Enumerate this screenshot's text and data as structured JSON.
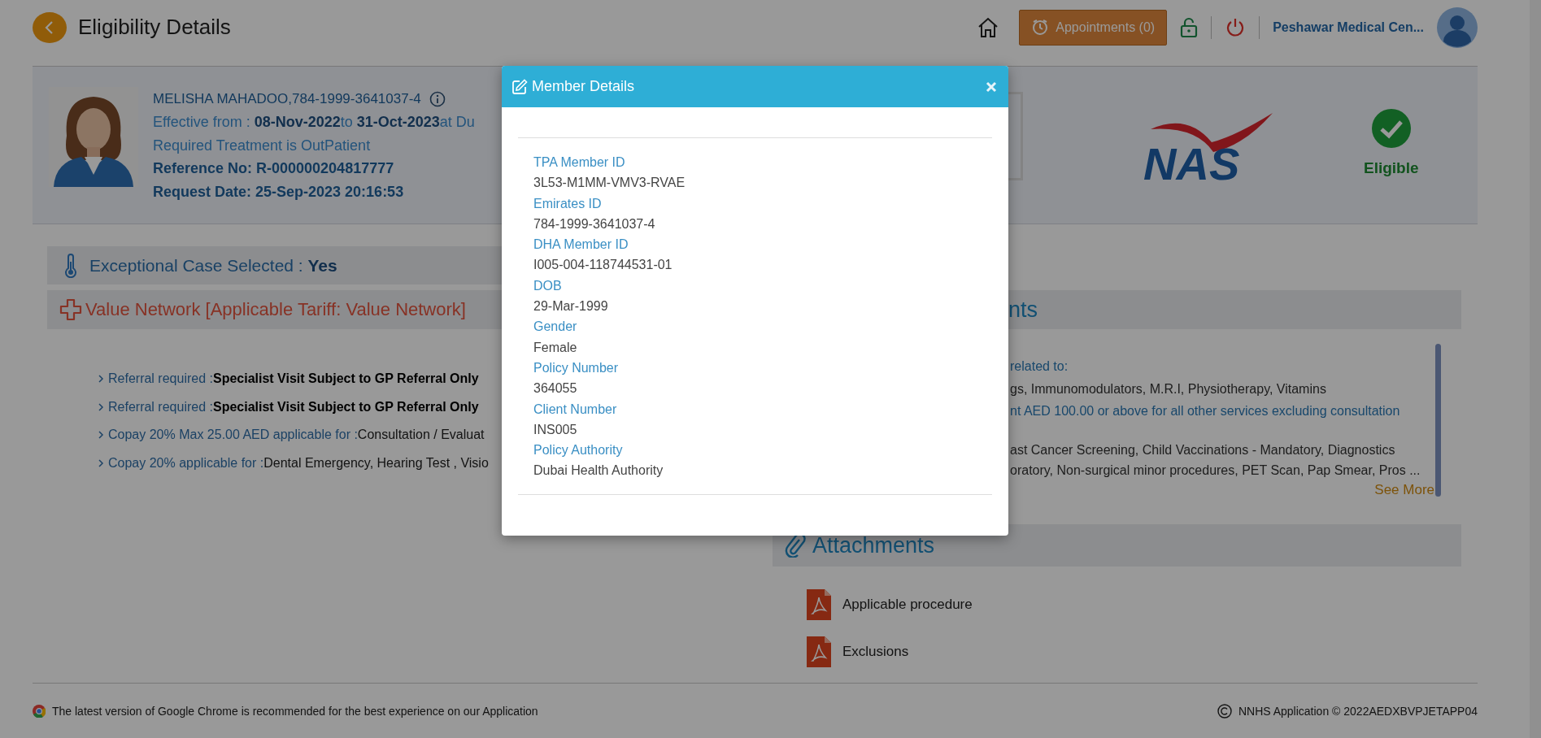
{
  "header": {
    "title": "Eligibility Details",
    "appointments": "Appointments (0)",
    "hospital": "Peshawar Medical Cen..."
  },
  "patient": {
    "name_line": "MELISHA MAHADOO,784-1999-3641037-4",
    "effective": "Effective from : **08-Nov-2022**to **31-Oct-2023**at Du",
    "treatment": "Required Treatment is OutPatient",
    "reference": "Reference No: R-000000204817777",
    "request_date": "Request Date: 25-Sep-2023 20:16:53"
  },
  "insurer": {
    "logo_text": "NAS",
    "status": "Eligible",
    "eligible": true
  },
  "exceptional": {
    "label": "Exceptional Case Selected : ",
    "value": "Yes"
  },
  "network": "Value Network [Applicable Tariff: Value Network]",
  "rules": [
    {
      "label": "Referral required :",
      "value": "Specialist Visit Subject to GP Referral Only",
      "emphasis": true
    },
    {
      "label": "Referral required :",
      "value": "Specialist Visit Subject to GP Referral Only",
      "emphasis": true
    },
    {
      "label": "Copay 20% Max 25.00 AED applicable for :",
      "value": "Consultation / Evaluat",
      "emphasis": false
    },
    {
      "label": "Copay 20% applicable for :",
      "value": "Dental Emergency, Hearing Test , Visio",
      "emphasis": false
    }
  ],
  "requirements": {
    "heading": "nts",
    "lines": [
      {
        "kind": "label",
        "text": "related to:"
      },
      {
        "kind": "text",
        "text": "gs, Immunomodulators, M.R.I, Physiotherapy, Vitamins"
      },
      {
        "kind": "label",
        "text": "nt AED 100.00 or above for all other services excluding consultation"
      },
      {
        "kind": "gap"
      },
      {
        "kind": "text",
        "text": "ast Cancer Screening, Child Vaccinations - Mandatory, Diagnostics"
      },
      {
        "kind": "text",
        "text": "oratory, Non-surgical minor procedures, PET Scan, Pap Smear, Pros ..."
      }
    ],
    "see_more": "See More"
  },
  "attachments": {
    "title": "Attachments",
    "files": [
      "Applicable procedure",
      "Exclusions"
    ]
  },
  "footer": {
    "notice": "The latest version of Google Chrome is recommended for the best experience on our Application",
    "copyright": "NNHS Application © 2022AEDXBVPJETAPP04"
  },
  "modal": {
    "title": "Member Details",
    "fields": [
      {
        "label": "TPA Member ID",
        "value": "3L53-M1MM-VMV3-RVAE"
      },
      {
        "label": "Emirates ID",
        "value": "784-1999-3641037-4"
      },
      {
        "label": "DHA Member ID",
        "value": "I005-004-118744531-01"
      },
      {
        "label": "DOB",
        "value": "29-Mar-1999"
      },
      {
        "label": "Gender",
        "value": "Female"
      },
      {
        "label": "Policy Number",
        "value": "364055"
      },
      {
        "label": "Client Number",
        "value": "INS005"
      },
      {
        "label": "Policy Authority",
        "value": "Dubai Health Authority"
      }
    ]
  }
}
